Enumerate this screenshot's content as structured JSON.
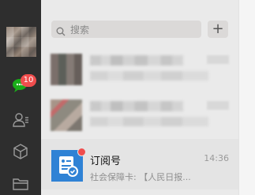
{
  "sidebar": {
    "icons": [
      "avatar",
      "chat-icon",
      "contacts-icon",
      "cube-icon",
      "folder-icon"
    ],
    "chat_badge": "10"
  },
  "search": {
    "placeholder": "搜索",
    "add_label": "+"
  },
  "conversations": [
    {
      "blurred": true
    },
    {
      "blurred": true
    },
    {
      "name": "订阅号",
      "time": "14:36",
      "preview": "社会保障卡: 【人民日报...",
      "unread_dot": true
    }
  ],
  "colors": {
    "sidebar_bg": "#2e2e2e",
    "list_bg": "#eaeaea",
    "badge": "#f04d4d",
    "subscription_avatar": "#2f82d5"
  }
}
